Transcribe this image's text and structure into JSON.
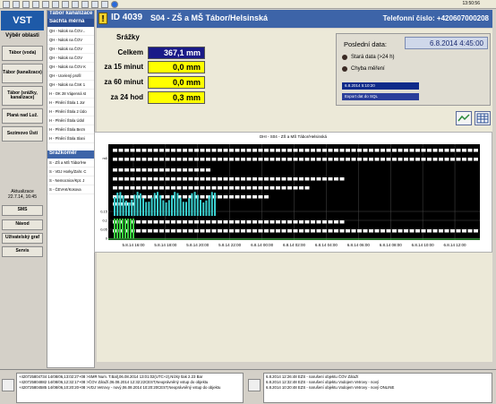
{
  "toolbar": {
    "clock": "13:50:56"
  },
  "sidebar": {
    "logo": "VST",
    "header": "Výběr oblasti",
    "buttons": [
      "Tábor (voda)",
      "Tábor (kanalizace)",
      "Tábor (srážky, kanalizace)",
      "Planá nad Luž.",
      "Sezimovo Ústí"
    ],
    "aktualizace_label": "Aktualizace",
    "aktualizace_value": "22.7.14, 16:45",
    "bottom_buttons": [
      "SMS",
      "Návod",
      "Uživatelský graf",
      "Servis"
    ]
  },
  "list": {
    "header1": "Tábor kanalizace",
    "header2": "Šachta měrná",
    "items": [
      "QH - Nátok na ČOV...",
      "QH - Nátok na ČOV",
      "QH - Nátok na ČOV",
      "QH - Nátok na ČOV",
      "QH - Nátok na ČOV K",
      "QH - Ucelený profil",
      "QH - Nátok na ČSK 1",
      "H - OK 28 Vápenná st",
      "H - Plnění Štola 1 Jor",
      "H - Plnění Štola 2 Údo",
      "H - Plnění Štola Údol",
      "H - Plnění Štola Bezn",
      "H - Plnění Štola Slani"
    ],
    "header3": "Srážkoměr",
    "items2": [
      "S - ZŠ a MŠ Tábor/He",
      "S - VDJ Horky/Zahr. C",
      "S - Nemocnice/Kpt. J",
      "S - ČEVAK/Kosova"
    ]
  },
  "station": {
    "id": "ID 4039",
    "name": "S04 - ZŠ a MŠ Tábor/Helsinská",
    "phone": "Telefonní číslo: +420607000208"
  },
  "rain": {
    "section": "Srážky",
    "rows": [
      {
        "label": "Celkem",
        "value": "367,1 mm"
      },
      {
        "label": "za 15 minut",
        "value": "0,0 mm"
      },
      {
        "label": "za 60 minut",
        "value": "0,0 mm"
      },
      {
        "label": "za 24 hod",
        "value": "0,3 mm"
      }
    ]
  },
  "info": {
    "last_label": "Poslední data:",
    "last_value": "6.8.2014 4:45:00",
    "stale": "Stará data (>24 h)",
    "error": "Chyba měření",
    "bar1": "6.8.2014 5:10:20",
    "export": "Export dat do SQL"
  },
  "chart_data": {
    "type": "line",
    "title": "DHI - S04 - ZŠ a MŠ Tábor/Helsinská",
    "x_ticks": [
      "5.8.14 16:00",
      "5.8.14 18:00",
      "5.8.14 20:00",
      "5.8.14 22:00",
      "6.8.14 00:00",
      "6.8.14 02:00",
      "6.8.14 04:00",
      "6.8.14 06:00",
      "6.8.14 08:00",
      "6.8.14 10:00",
      "6.8.14 12:00"
    ],
    "x_start": "5.8.14 14:00",
    "upper_label": "m0",
    "lower_ticks": [
      "0,15",
      "0,1",
      "0,05",
      "0"
    ],
    "axis_upper_label": "mm 24 hod"
  },
  "status": {
    "left": [
      "+420725804734 14/08/06,13:02:27+08 >SMR Num. T.Bal|,06.08.2014 13:01:02(UTC+2),Nízký tlak 2.23 Bar",
      "+420725804882 14/08/06,12:32:17+08 >ČOV Zátuží,06.08.2014 12:32:22CEST,Neoprávněný vstup do objektu",
      "+420725804585 14/08/06,10:20:20+08 >VDJ Vetrovy - nový,06.08.2014 10:20:20CEST,Neoprávněný vstup do objektu"
    ],
    "right": [
      "6.8.2014 12:26:48  EZS - narušení objektu ČOV Zátuží",
      "6.8.2014 12:32:48  EZS - narušení objektu Vodojem Vetrovy - nový",
      "6.8.2014 10:20:48  EZS - narušení objektu Vodojem Vetrovy - nový ONLINE"
    ]
  }
}
